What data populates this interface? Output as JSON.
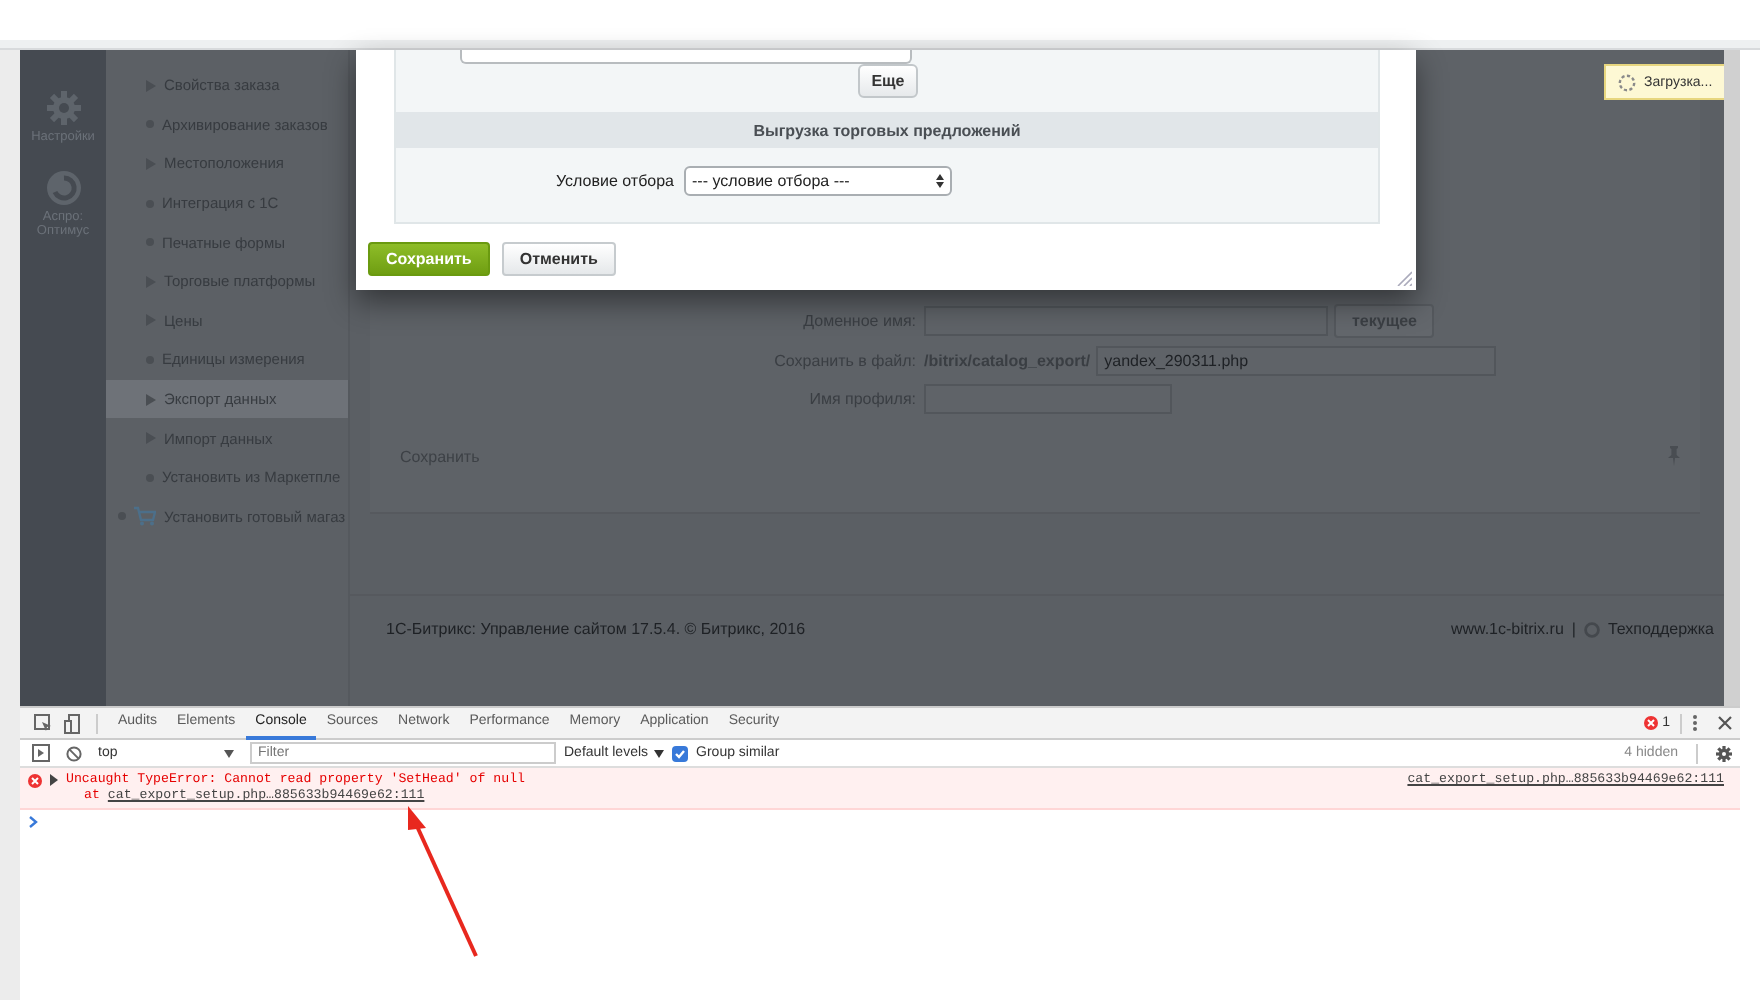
{
  "page": {
    "sidebar": {
      "items": [
        {
          "kind": "gear",
          "label": "Настройки"
        },
        {
          "kind": "logo",
          "label": "Аспро: Оптимус"
        }
      ]
    },
    "menu": {
      "items": [
        {
          "kind": "page",
          "label": "Свойства заказа",
          "expandable": true,
          "selected": false
        },
        {
          "kind": "page",
          "label": "Архивирование заказов",
          "expandable": false,
          "selected": false
        },
        {
          "kind": "page",
          "label": "Местоположения",
          "expandable": true,
          "selected": false
        },
        {
          "kind": "page",
          "label": "Интеграция с 1С",
          "expandable": false,
          "selected": false
        },
        {
          "kind": "page",
          "label": "Печатные формы",
          "expandable": false,
          "selected": false
        },
        {
          "kind": "page",
          "label": "Торговые платформы",
          "expandable": true,
          "selected": false
        },
        {
          "kind": "page",
          "label": "Цены",
          "expandable": true,
          "selected": false
        },
        {
          "kind": "page",
          "label": "Единицы измерения",
          "expandable": false,
          "selected": false
        },
        {
          "kind": "page",
          "label": "Экспорт данных",
          "expandable": true,
          "selected": true
        },
        {
          "kind": "page",
          "label": "Импорт данных",
          "expandable": true,
          "selected": false
        },
        {
          "kind": "page",
          "label": "Установить из Маркетпле",
          "expandable": false,
          "selected": false
        },
        {
          "kind": "cart",
          "label": "Установить готовый магаз",
          "expandable": false,
          "selected": false
        }
      ]
    },
    "loading_notice": {
      "text": "Загрузка..."
    },
    "form": {
      "domain_label": "Доменное имя:",
      "domain_button": "текущее",
      "file_label": "Сохранить в файл:",
      "file_path": "/bitrix/catalog_export/",
      "file_value": "yandex_290311.php",
      "profile_label": "Имя профиля:",
      "save_button": "Сохранить"
    },
    "footer": {
      "copyright": "1С-Битрикс: Управление сайтом 17.5.4. © Битрикс, 2016",
      "site_link": "www.1c-bitrix.ru",
      "separator": "|",
      "support_link": "Техподдержка"
    },
    "dialog": {
      "more_button": "Еще",
      "section_title": "Выгрузка торговых предложений",
      "filter_label": "Условие отбора",
      "filter_select": "--- условие отбора ---",
      "buttons": [
        {
          "kind": "primary",
          "label": "Сохранить"
        },
        {
          "kind": "secondary",
          "label": "Отменить"
        }
      ]
    }
  },
  "devtools": {
    "tabs": [
      {
        "label": "Audits",
        "selected": false
      },
      {
        "label": "Elements",
        "selected": false
      },
      {
        "label": "Console",
        "selected": true
      },
      {
        "label": "Sources",
        "selected": false
      },
      {
        "label": "Network",
        "selected": false
      },
      {
        "label": "Performance",
        "selected": false
      },
      {
        "label": "Memory",
        "selected": false
      },
      {
        "label": "Application",
        "selected": false
      },
      {
        "label": "Security",
        "selected": false
      }
    ],
    "error_count": "1",
    "context": "top",
    "filter_placeholder": "Filter",
    "levels": "Default levels",
    "group_similar": {
      "label": "Group similar",
      "checked": true
    },
    "hidden_count": "4 hidden",
    "messages": [
      {
        "kind": "error",
        "expanded": false,
        "text": "Uncaught TypeError: Cannot read property 'SetHead' of null",
        "stack_prefix": "at",
        "stack_link": "cat_export_setup.php…885633b94469e62:111",
        "source": "cat_export_setup.php…885633b94469e62:111"
      }
    ]
  }
}
